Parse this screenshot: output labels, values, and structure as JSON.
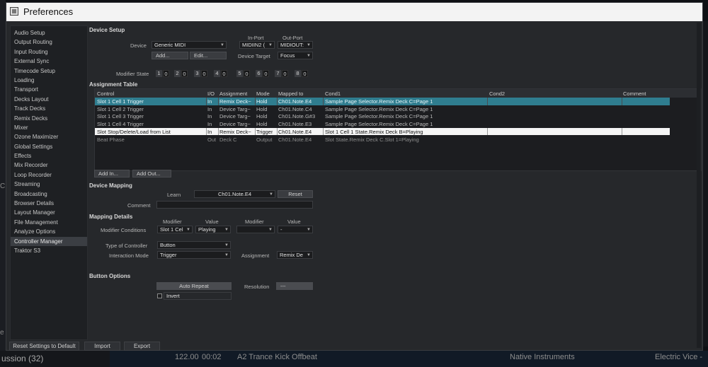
{
  "window": {
    "title": "Preferences"
  },
  "sidebar": {
    "items": [
      {
        "label": "Audio Setup"
      },
      {
        "label": "Output Routing"
      },
      {
        "label": "Input Routing"
      },
      {
        "label": "External Sync"
      },
      {
        "label": "Timecode Setup"
      },
      {
        "label": "Loading"
      },
      {
        "label": "Transport"
      },
      {
        "label": "Decks Layout"
      },
      {
        "label": "Track Decks"
      },
      {
        "label": "Remix Decks"
      },
      {
        "label": "Mixer"
      },
      {
        "label": "Ozone Maximizer"
      },
      {
        "label": "Global Settings"
      },
      {
        "label": "Effects"
      },
      {
        "label": "Mix Recorder"
      },
      {
        "label": "Loop Recorder"
      },
      {
        "label": "Streaming"
      },
      {
        "label": "Broadcasting"
      },
      {
        "label": "Browser Details"
      },
      {
        "label": "Layout Manager"
      },
      {
        "label": "File Management"
      },
      {
        "label": "Analyze Options"
      },
      {
        "label": "Controller Manager"
      },
      {
        "label": "Traktor S3"
      }
    ],
    "active_index": 22
  },
  "device_setup": {
    "heading": "Device Setup",
    "device_label": "Device",
    "device_value": "Generic MIDI",
    "add_label": "Add...",
    "edit_label": "Edit...",
    "in_port_label": "In-Port",
    "in_port_value": "MIDIIN2 (",
    "out_port_label": "Out-Port",
    "out_port_value": "MIDIOUT:",
    "device_target_label": "Device Target",
    "device_target_value": "Focus",
    "modifier_state_label": "Modifier State",
    "modifiers": [
      {
        "num": "1",
        "val": "0"
      },
      {
        "num": "2",
        "val": "0"
      },
      {
        "num": "3",
        "val": "0"
      },
      {
        "num": "4",
        "val": "0"
      },
      {
        "num": "5",
        "val": "0"
      },
      {
        "num": "6",
        "val": "0"
      },
      {
        "num": "7",
        "val": "0"
      },
      {
        "num": "8",
        "val": "0"
      }
    ]
  },
  "assignment_table": {
    "heading": "Assignment Table",
    "columns": [
      "Control",
      "I/O",
      "Assignment",
      "Mode",
      "Mapped to",
      "Cond1",
      "Cond2",
      "Comment"
    ],
    "rows": [
      {
        "control": "Slot 1 Cell 1 Trigger",
        "io": "In",
        "assignment": "Remix Deck~",
        "mode": "Hold",
        "mapped": "Ch01.Note.E4",
        "cond1": "Sample Page Selector.Remix Deck C=Page 1",
        "cond2": "",
        "comment": ""
      },
      {
        "control": "Slot 1 Cell 2 Trigger",
        "io": "In",
        "assignment": "Device Targ~",
        "mode": "Hold",
        "mapped": "Ch01.Note.C4",
        "cond1": "Sample Page Selector.Remix Deck C=Page 1",
        "cond2": "",
        "comment": ""
      },
      {
        "control": "Slot 1 Cell 3 Trigger",
        "io": "In",
        "assignment": "Device Targ~",
        "mode": "Hold",
        "mapped": "Ch01.Note.G#3",
        "cond1": "Sample Page Selector.Remix Deck C=Page 1",
        "cond2": "",
        "comment": ""
      },
      {
        "control": "Slot 1 Cell 4 Trigger",
        "io": "In",
        "assignment": "Device Targ~",
        "mode": "Hold",
        "mapped": "Ch01.Note.E3",
        "cond1": "Sample Page Selector.Remix Deck C=Page 1",
        "cond2": "",
        "comment": ""
      },
      {
        "control": "Slot Stop/Delete/Load from List",
        "io": "In",
        "assignment": "Remix Deck~",
        "mode": "Trigger",
        "mapped": "Ch01.Note.E4",
        "cond1": "Slot 1 Cell 1 State.Remix Deck B=Playing",
        "cond2": "",
        "comment": ""
      },
      {
        "control": "Beat Phase",
        "io": "Out",
        "assignment": "Deck C",
        "mode": "Output",
        "mapped": "Ch01.Note.E4",
        "cond1": "Slot State.Remix Deck C.Slot 1=Playing",
        "cond2": "",
        "comment": ""
      }
    ],
    "add_in_label": "Add In...",
    "add_out_label": "Add Out..."
  },
  "device_mapping": {
    "heading": "Device Mapping",
    "learn_label": "Learn",
    "learn_value": "Ch01.Note.E4",
    "reset_label": "Reset",
    "comment_label": "Comment",
    "comment_value": ""
  },
  "mapping_details": {
    "heading": "Mapping Details",
    "modifier_header": "Modifier",
    "value_header": "Value",
    "modifier_header2": "Modifier",
    "value_header2": "Value",
    "modifier_conditions_label": "Modifier Conditions",
    "cond1_modifier": "Slot 1 Cel",
    "cond1_value": "Playing",
    "cond2_modifier": "",
    "cond2_value": "-",
    "type_label": "Type of Controller",
    "type_value": "Button",
    "interaction_label": "Interaction Mode",
    "interaction_value": "Trigger",
    "assignment_label": "Assignment",
    "assignment_value": "Remix De"
  },
  "button_options": {
    "heading": "Button Options",
    "auto_repeat_label": "Auto Repeat",
    "resolution_label": "Resolution",
    "resolution_value": "---",
    "invert_label": "Invert"
  },
  "footer": {
    "reset_label": "Reset Settings to Default",
    "import_label": "Import",
    "export_label": "Export"
  },
  "background_library": {
    "left_text": "ussion (32)",
    "bpm": "122.00",
    "time": "00:02",
    "title": "A2 Trance Kick Offbeat",
    "artist": "Native Instruments",
    "release": "Electric Vice -"
  }
}
